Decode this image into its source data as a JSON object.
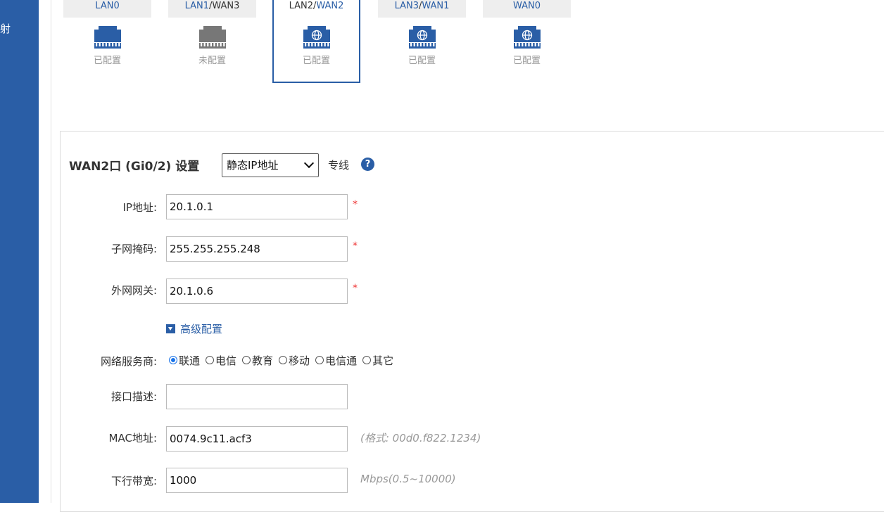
{
  "sidebar": {
    "item_partial": "射"
  },
  "ports": [
    {
      "label_a": "LAN0",
      "label_sep": "",
      "label_b": "",
      "state": "已配置",
      "icon": "ethernet-port-icon",
      "active": true,
      "selected": false
    },
    {
      "label_a": "LAN1",
      "label_sep": "/",
      "label_b": "WAN3",
      "state": "未配置",
      "icon": "ethernet-port-icon",
      "active": false,
      "selected": false
    },
    {
      "label_a": "LAN2",
      "label_sep": "/",
      "label_b": "WAN2",
      "state": "已配置",
      "icon": "globe-port-icon",
      "active": true,
      "selected": true
    },
    {
      "label_a": "LAN3",
      "label_sep": "/",
      "label_b": "WAN1",
      "state": "已配置",
      "icon": "globe-port-icon",
      "active": true,
      "selected": false
    },
    {
      "label_a": "",
      "label_sep": "",
      "label_b": "WAN0",
      "state": "已配置",
      "icon": "globe-port-icon",
      "active": true,
      "selected": false
    }
  ],
  "settings": {
    "title": "WAN2口 (Gi0/2) 设置",
    "mode": "静态IP地址",
    "line_type": "专线",
    "help_icon": "?"
  },
  "form": {
    "ip_label": "IP地址:",
    "ip_value": "20.1.0.1",
    "mask_label": "子网掩码:",
    "mask_value": "255.255.255.248",
    "gateway_label": "外网网关:",
    "gateway_value": "20.1.0.6",
    "required_mark": "*",
    "advanced_label": "高级配置",
    "isp_label": "网络服务商:",
    "isp_options": [
      "联通",
      "电信",
      "教育",
      "移动",
      "电信通",
      "其它"
    ],
    "isp_selected": "联通",
    "desc_label": "接口描述:",
    "desc_value": "",
    "mac_label": "MAC地址:",
    "mac_value": "0074.9c11.acf3",
    "mac_hint": "(格式:  00d0.f822.1234)",
    "bw_label": "下行带宽:",
    "bw_value": "1000",
    "bw_hint": "Mbps(0.5~10000)"
  },
  "colors": {
    "accent": "#2a5ea6",
    "port_inactive": "#777777",
    "required": "#ee3333"
  }
}
